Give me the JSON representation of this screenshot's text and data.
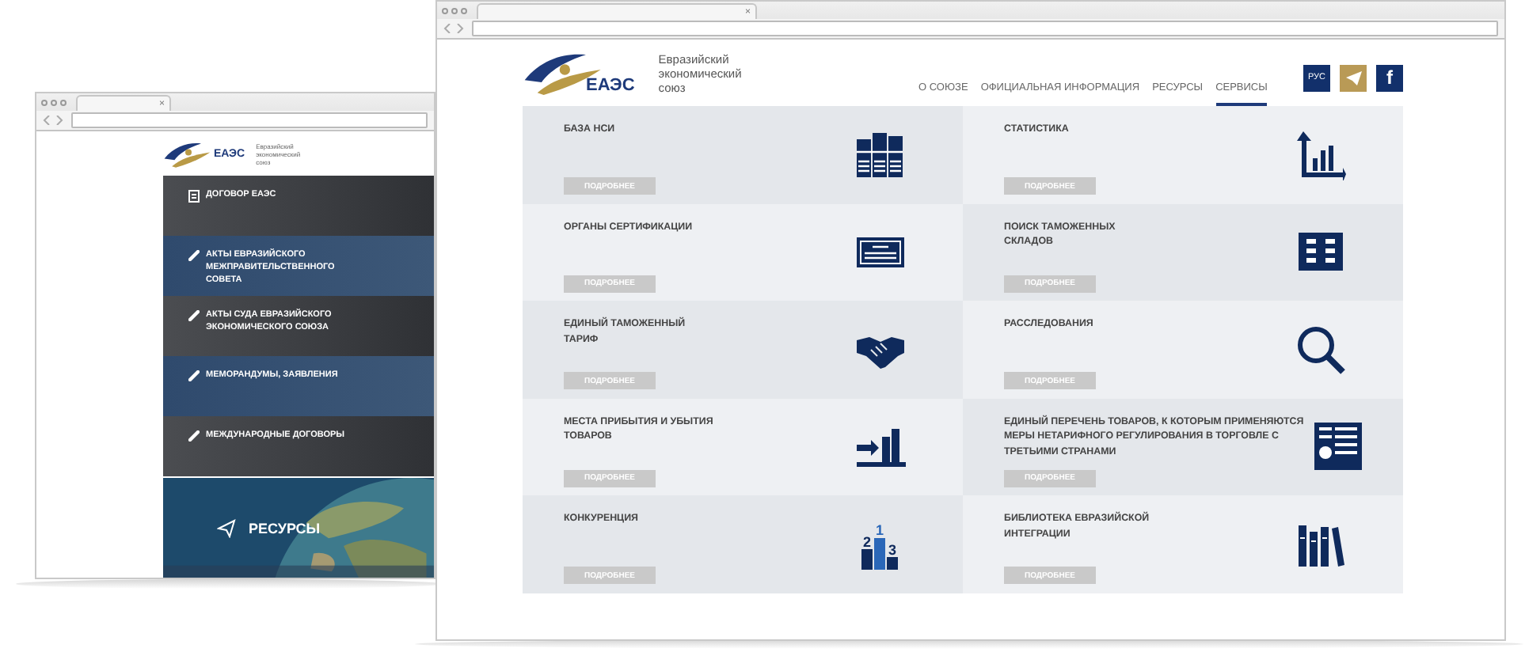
{
  "back_window": {
    "tab_close": "×",
    "logo": {
      "abbr": "ЕАЭС",
      "name": "Евразийский экономический союз"
    },
    "panels": [
      {
        "title": "ДОГОВОР ЕАЭС",
        "kind": "document"
      },
      {
        "title": "АКТЫ ЕВРАЗИЙСКОГО МЕЖПРАВИТЕЛЬСТВЕННОГО СОВЕТА",
        "kind": "link"
      },
      {
        "title": "АКТЫ СУДА ЕВРАЗИЙСКОГО ЭКОНОМИЧЕСКОГО СОЮЗА",
        "kind": "link"
      },
      {
        "title": "МЕМОРАНДУМЫ, ЗАЯВЛЕНИЯ",
        "kind": "link"
      },
      {
        "title": "МЕЖДУНАРОДНЫЕ ДОГОВОРЫ",
        "kind": "link"
      }
    ],
    "resources": {
      "title": "РЕСУРСЫ",
      "kind": "picture"
    }
  },
  "front_window": {
    "tab_close": "×",
    "logo": {
      "abbr": "ЕАЭС",
      "name": "Евразийский экономический союз"
    },
    "nav": [
      {
        "label": "О СОЮЗЕ",
        "selected": false
      },
      {
        "label": "ОФИЦИАЛЬНАЯ ИНФОРМАЦИЯ",
        "selected": false
      },
      {
        "label": "РЕСУРСЫ",
        "selected": false
      },
      {
        "label": "СЕРВИСЫ",
        "selected": true
      }
    ],
    "language": "РУС",
    "social": [
      {
        "kind": "telegram"
      },
      {
        "kind": "facebook",
        "label": "f"
      }
    ],
    "services": [
      {
        "title": "БАЗА НСИ",
        "button": "ПОДРОБНЕЕ",
        "kind": "binders"
      },
      {
        "title": "СТАТИСТИКА",
        "button": "ПОДРОБНЕЕ",
        "kind": "chart"
      },
      {
        "title": "ОРГАНЫ СЕРТИФИКАЦИИ",
        "button": "ПОДРОБНЕЕ",
        "kind": "certificate"
      },
      {
        "title": "ПОИСК ТАМОЖЕННЫХ СКЛАДОВ",
        "button": "ПОДРОБНЕЕ",
        "kind": "building"
      },
      {
        "title": "ЕДИНЫЙ ТАМОЖЕННЫЙ ТАРИФ",
        "button": "ПОДРОБНЕЕ",
        "kind": "handshake"
      },
      {
        "title": "РАССЛЕДОВАНИЯ",
        "button": "ПОДРОБНЕЕ",
        "kind": "search"
      },
      {
        "title": "МЕСТА ПРИБЫТИЯ И УБЫТИЯ ТОВАРОВ",
        "button": "ПОДРОБНЕЕ",
        "kind": "arrival"
      },
      {
        "title": "ЕДИНЫЙ ПЕРЕЧЕНЬ ТОВАРОВ, К КОТОРЫМ ПРИМЕНЯЮТСЯ МЕРЫ НЕТАРИФНОГО РЕГУЛИРОВАНИЯ В ТОРГОВЛЕ С ТРЕТЬИМИ СТРАНАМИ",
        "button": "ПОДРОБНЕЕ",
        "kind": "list"
      },
      {
        "title": "КОНКУРЕНЦИЯ",
        "button": "ПОДРОБНЕЕ",
        "kind": "podium",
        "icon_text": [
          "2",
          "1",
          "3"
        ]
      },
      {
        "title": "БИБЛИОТЕКА ЕВРАЗИЙСКОЙ ИНТЕГРАЦИИ",
        "button": "ПОДРОБНЕЕ",
        "kind": "books"
      }
    ]
  }
}
